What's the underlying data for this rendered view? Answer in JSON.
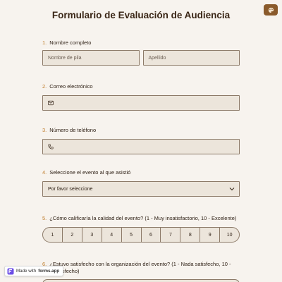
{
  "colors": {
    "accent": "#c07d2c",
    "background": "#f7f3ee",
    "field": "#ece5db",
    "border": "#8c7a68",
    "theme_button": "#8a5a2b"
  },
  "form": {
    "title": "Formulario de Evaluación de Audiencia",
    "q1": {
      "number": "1.",
      "label": "Nombre completo",
      "first_placeholder": "Nombre de pila",
      "last_placeholder": "Apellido"
    },
    "q2": {
      "number": "2.",
      "label": "Correo electrónico",
      "icon": "envelope-icon"
    },
    "q3": {
      "number": "3.",
      "label": "Número de teléfono",
      "icon": "phone-icon"
    },
    "q4": {
      "number": "4.",
      "label": "Seleccione el evento al que asistió",
      "selected": "Por favor seleccione",
      "icon": "chevron-down-icon"
    },
    "q5": {
      "number": "5.",
      "label": "¿Cómo calificaría la calidad del evento? (1 - Muy insatisfactorio, 10 - Excelente)",
      "options": [
        "1",
        "2",
        "3",
        "4",
        "5",
        "6",
        "7",
        "8",
        "9",
        "10"
      ]
    },
    "q6": {
      "number": "6.",
      "label": "¿Estuvo satisfecho con la organización del evento? (1 - Nada satisfecho, 10 - Muy satisfecho)"
    }
  },
  "badge": {
    "prefix": "Made with",
    "brand": "forms.app"
  }
}
